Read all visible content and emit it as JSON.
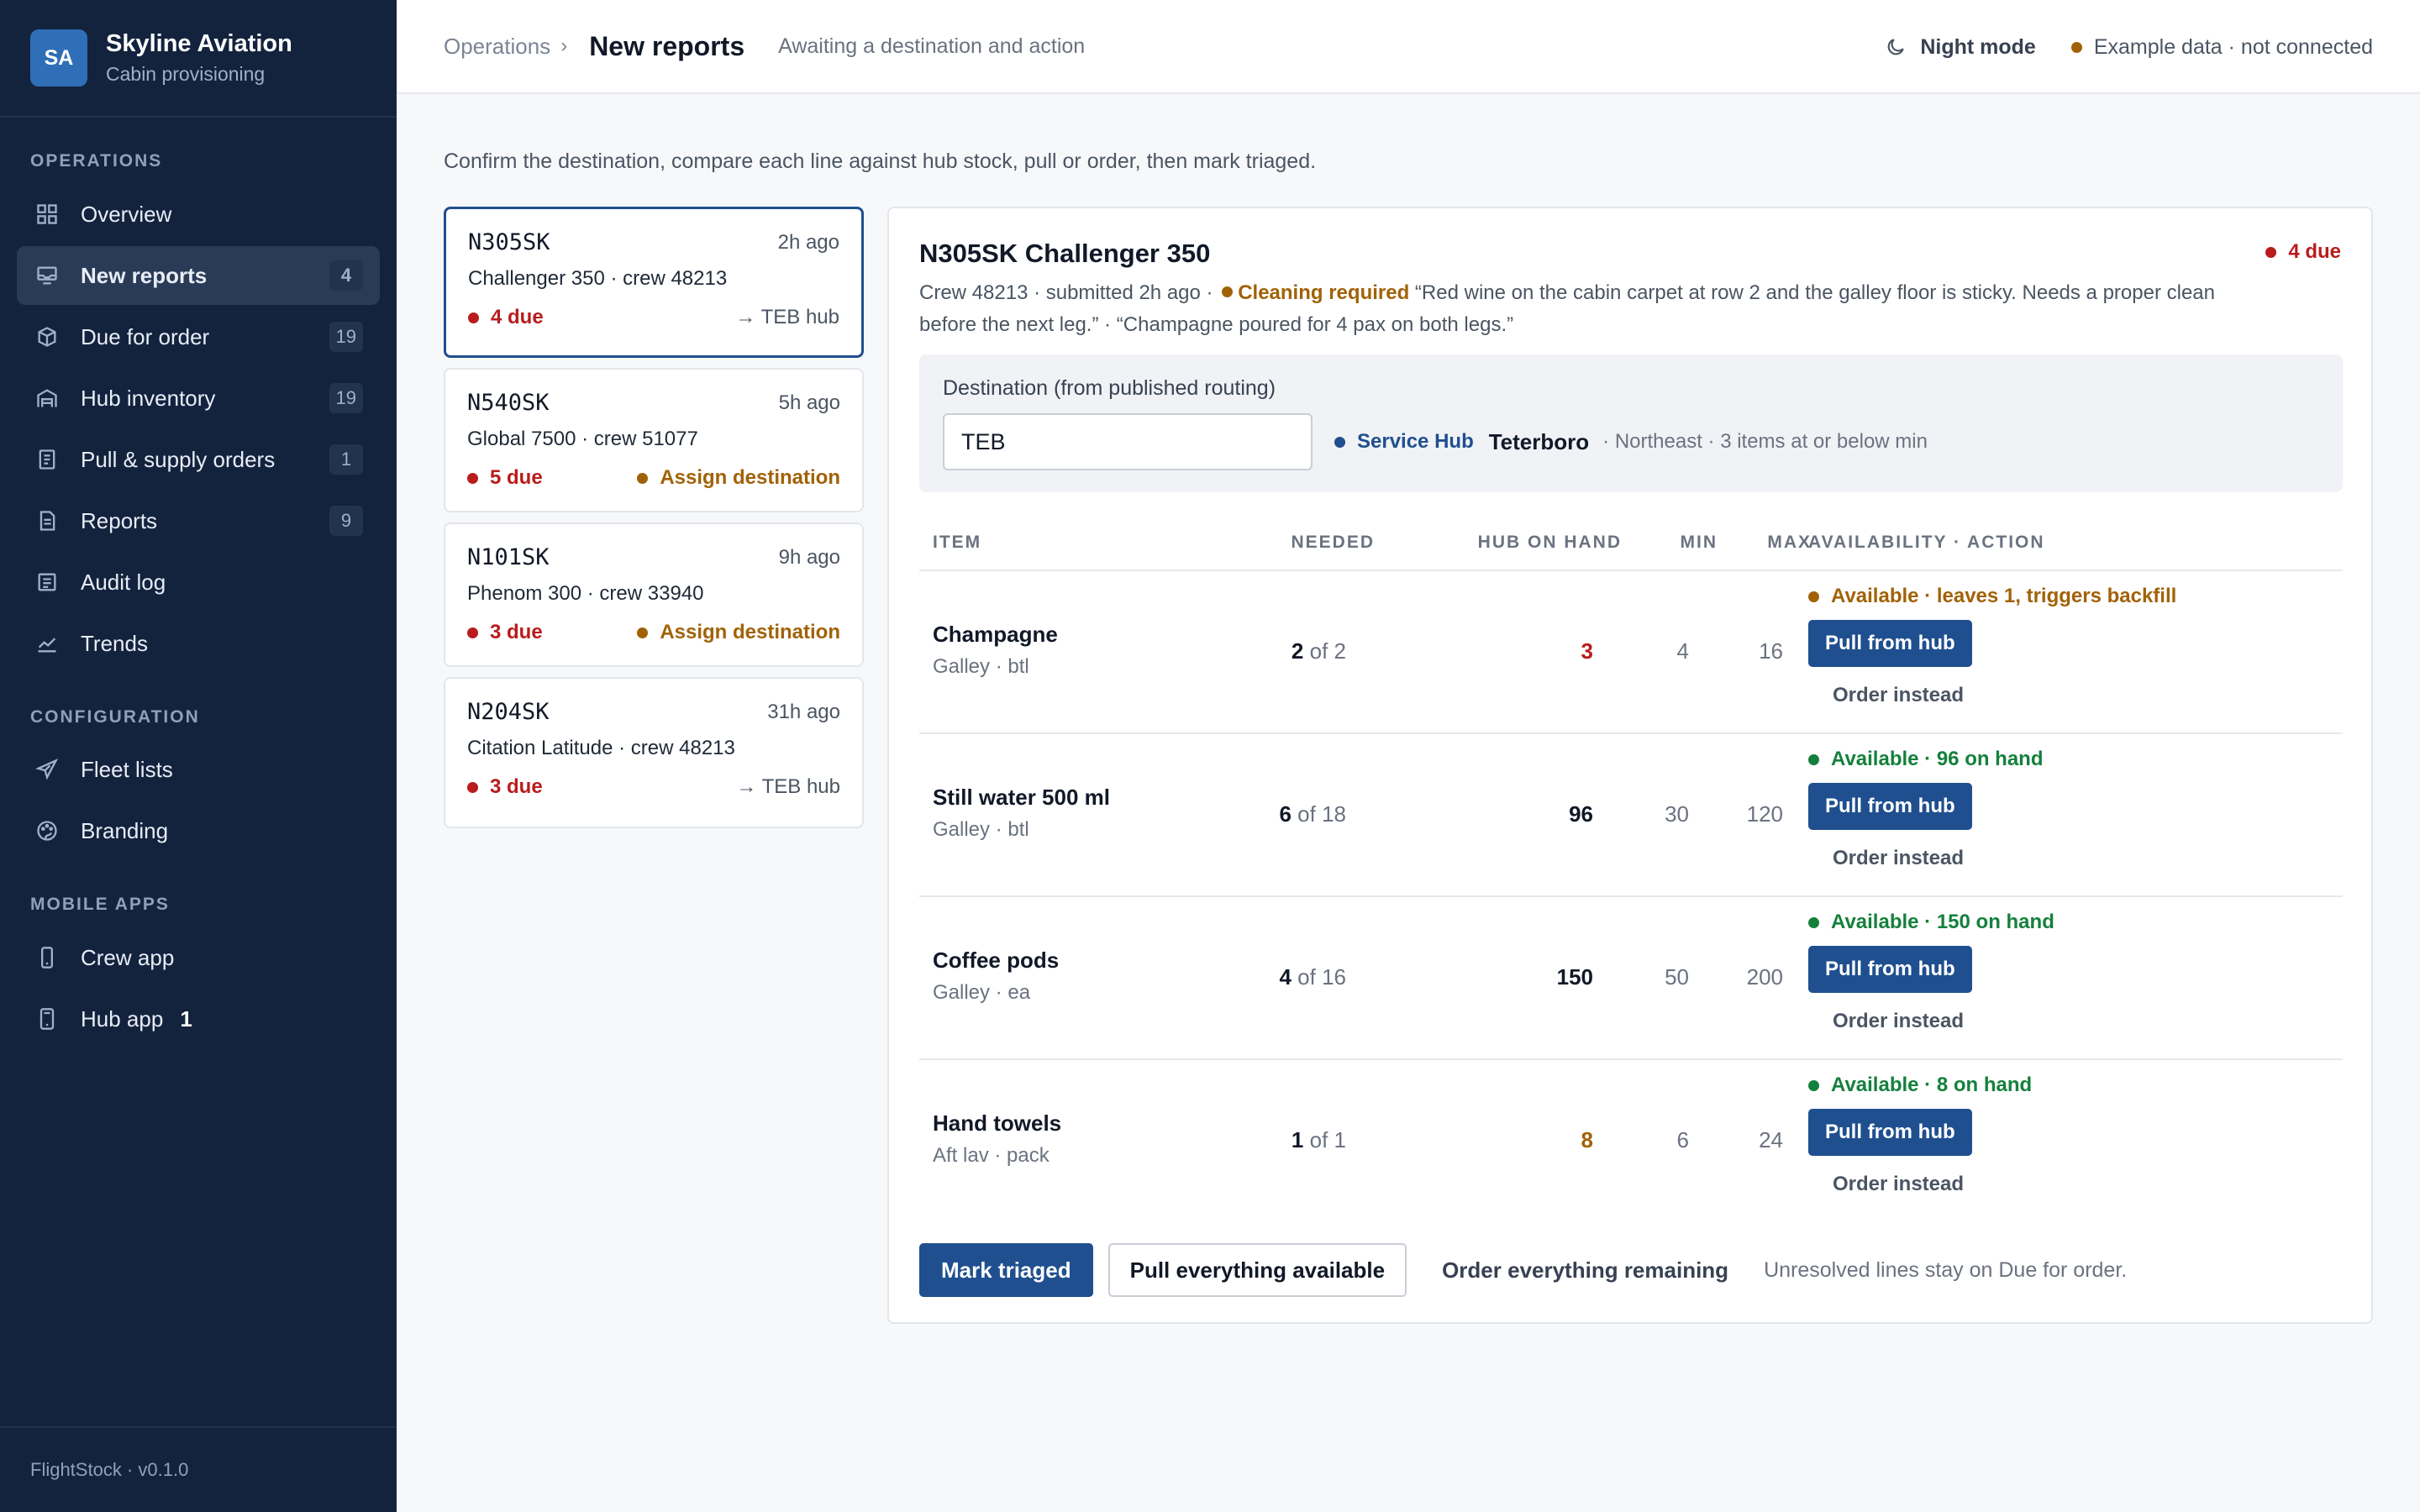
{
  "colors": {
    "accent": "#1f4f8f",
    "sidebar_bg": "#13233e",
    "danger": "#b91c1c",
    "warning": "#a16207",
    "success": "#15803d"
  },
  "sidebar": {
    "avatar": "SA",
    "brand_name": "Skyline Aviation",
    "brand_sub": "Cabin provisioning",
    "sections": {
      "operations": "OPERATIONS",
      "configuration": "CONFIGURATION",
      "mobile_apps": "MOBILE APPS"
    },
    "items": [
      {
        "label": "Overview",
        "icon": "grid-icon"
      },
      {
        "label": "New reports",
        "icon": "inbox-icon",
        "badge": "4",
        "active": true
      },
      {
        "label": "Due for order",
        "icon": "box-icon",
        "badge": "19"
      },
      {
        "label": "Hub inventory",
        "icon": "warehouse-icon",
        "badge": "19"
      },
      {
        "label": "Pull & supply orders",
        "icon": "clipboard-icon",
        "badge": "1"
      },
      {
        "label": "Reports",
        "icon": "document-icon",
        "badge": "9"
      },
      {
        "label": "Audit log",
        "icon": "list-icon"
      },
      {
        "label": "Trends",
        "icon": "trend-icon"
      },
      {
        "label": "Fleet lists",
        "icon": "plane-icon"
      },
      {
        "label": "Branding",
        "icon": "palette-icon"
      },
      {
        "label": "Crew app",
        "icon": "phone-icon"
      },
      {
        "label": "Hub app",
        "icon": "tablet-icon",
        "badge": "1"
      }
    ],
    "footer": "FlightStock · v0.1.0"
  },
  "topbar": {
    "breadcrumb": "Operations",
    "breadcrumb_sep": "›",
    "title": "New reports",
    "subtitle": "Awaiting a destination and action",
    "night_mode": "Night mode",
    "status": "Example data · not connected"
  },
  "intro": "Confirm the destination, compare each line against hub stock, pull or order, then mark triaged.",
  "reports": [
    {
      "tail": "N305SK",
      "ago": "2h ago",
      "aircraft": "Challenger 350 · crew 48213",
      "due": "4 due",
      "right": "→ TEB hub",
      "right_type": "hub"
    },
    {
      "tail": "N540SK",
      "ago": "5h ago",
      "aircraft": "Global 7500 · crew 51077",
      "due": "5 due",
      "right": "Assign destination",
      "right_type": "assign"
    },
    {
      "tail": "N101SK",
      "ago": "9h ago",
      "aircraft": "Phenom 300 · crew 33940",
      "due": "3 due",
      "right": "Assign destination",
      "right_type": "assign"
    },
    {
      "tail": "N204SK",
      "ago": "31h ago",
      "aircraft": "Citation Latitude · crew 48213",
      "due": "3 due",
      "right": "→ TEB hub",
      "right_type": "hub"
    }
  ],
  "detail": {
    "title": "N305SK Challenger 350",
    "due": "4 due",
    "meta_prefix": "Crew 48213 · submitted 2h ago ·",
    "cleaning": "Cleaning required",
    "meta_quote": "“Red wine on the cabin carpet at row 2 and the galley floor is sticky. Needs a proper clean before the next leg.” · “Champagne poured for 4 pax on both legs.”",
    "destination_label": "Destination (from published routing)",
    "destination_value": "TEB",
    "service_hub": "Service Hub",
    "hub_name": "Teterboro",
    "hub_detail": "· Northeast · 3 items at or below min",
    "headers": {
      "item": "ITEM",
      "needed": "NEEDED",
      "onhand": "HUB ON HAND",
      "min": "MIN",
      "max": "MAX",
      "action": "AVAILABILITY · ACTION"
    },
    "lines": [
      {
        "name": "Champagne",
        "sub": "Galley · btl",
        "needed": "2",
        "of": "of 2",
        "onhand": "3",
        "onhand_color": "#b91c1c",
        "min": "4",
        "max": "16",
        "avail": "Available · leaves 1, triggers backfill",
        "avail_color": "#a16207",
        "pull": "Pull from hub",
        "order": "Order instead"
      },
      {
        "name": "Still water 500 ml",
        "sub": "Galley · btl",
        "needed": "6",
        "of": "of 18",
        "onhand": "96",
        "onhand_color": "#111827",
        "min": "30",
        "max": "120",
        "avail": "Available · 96 on hand",
        "avail_color": "#15803d",
        "pull": "Pull from hub",
        "order": "Order instead"
      },
      {
        "name": "Coffee pods",
        "sub": "Galley · ea",
        "needed": "4",
        "of": "of 16",
        "onhand": "150",
        "onhand_color": "#111827",
        "min": "50",
        "max": "200",
        "avail": "Available · 150 on hand",
        "avail_color": "#15803d",
        "pull": "Pull from hub",
        "order": "Order instead"
      },
      {
        "name": "Hand towels",
        "sub": "Aft lav · pack",
        "needed": "1",
        "of": "of 1",
        "onhand": "8",
        "onhand_color": "#a16207",
        "min": "6",
        "max": "24",
        "avail": "Available · 8 on hand",
        "avail_color": "#15803d",
        "pull": "Pull from hub",
        "order": "Order instead"
      }
    ],
    "actions": {
      "mark_triaged": "Mark triaged",
      "pull_all": "Pull everything available",
      "order_all": "Order everything remaining",
      "note": "Unresolved lines stay on Due for order."
    }
  }
}
